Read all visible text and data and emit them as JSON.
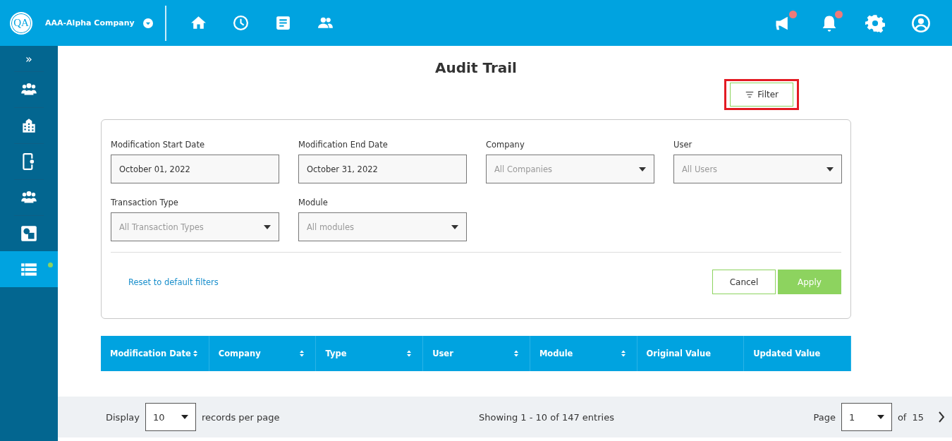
{
  "header": {
    "logo": "QA",
    "company": "AAA-Alpha Company",
    "nav": [
      {
        "selected": false
      },
      {
        "selected": false
      },
      {
        "selected": false
      },
      {
        "selected": false
      }
    ],
    "actions": [
      {
        "badge": true
      },
      {
        "badge": true
      },
      {
        "badge": false
      },
      {
        "badge": false
      }
    ]
  },
  "sidebar": {
    "toggle": "»",
    "items": [
      {
        "selected": false,
        "dot": false
      },
      {
        "selected": false,
        "dot": false
      },
      {
        "selected": false,
        "dot": false
      },
      {
        "selected": false,
        "dot": false
      },
      {
        "selected": false,
        "dot": false
      },
      {
        "selected": true,
        "dot": true
      }
    ]
  },
  "page": {
    "title": "Audit Trail",
    "filter_button": {
      "label": "Filter",
      "highlighted": true
    }
  },
  "filters": {
    "fields": [
      {
        "kind": "date",
        "label": "Modification Start Date",
        "value": "October 01, 2022"
      },
      {
        "kind": "date",
        "label": "Modification End Date",
        "value": "October 31, 2022"
      },
      {
        "kind": "select",
        "label": "Company",
        "placeholder": "All Companies"
      },
      {
        "kind": "select",
        "label": "User",
        "placeholder": "All Users"
      },
      {
        "kind": "select",
        "label": "Transaction Type",
        "placeholder": "All Transaction Types"
      },
      {
        "kind": "select",
        "label": "Module",
        "placeholder": "All modules"
      }
    ],
    "reset_link": "Reset to default filters",
    "buttons": [
      {
        "kind": "secondary",
        "label": "Cancel"
      },
      {
        "kind": "primary",
        "label": "Apply"
      }
    ]
  },
  "table": {
    "columns": [
      {
        "label": "Modification Date",
        "sortable": true
      },
      {
        "label": "Company",
        "sortable": true
      },
      {
        "label": "Type",
        "sortable": true
      },
      {
        "label": "User",
        "sortable": true
      },
      {
        "label": "Module",
        "sortable": true
      },
      {
        "label": "Original Value",
        "sortable": false
      },
      {
        "label": "Updated Value",
        "sortable": false
      }
    ]
  },
  "pagination": {
    "display_label": "Display",
    "page_size": "10",
    "per_page_label": "records per page",
    "summary": "Showing 1 - 10 of 147 entries",
    "page_label": "Page",
    "page": "1",
    "of_label": "of",
    "total_pages": "15"
  }
}
